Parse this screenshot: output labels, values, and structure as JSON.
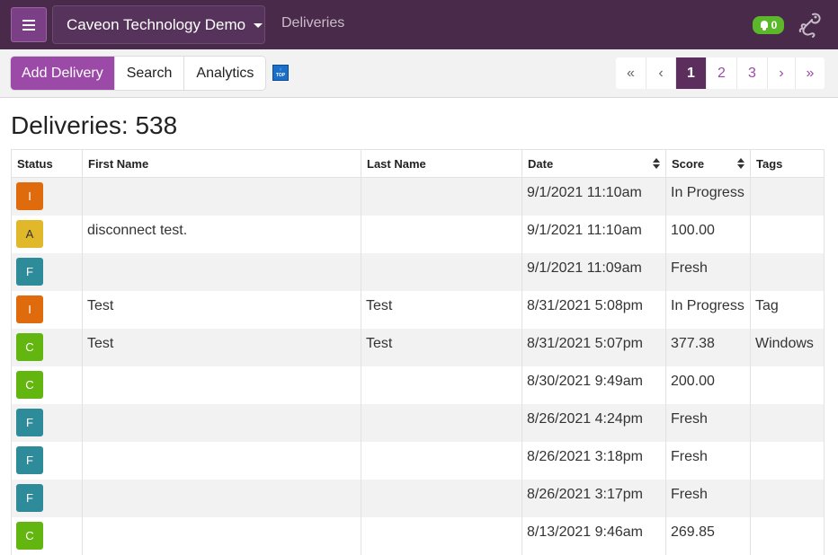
{
  "header": {
    "org_name": "Caveon Technology Demo",
    "breadcrumb": "Deliveries",
    "notification_count": "0"
  },
  "toolbar": {
    "add_label": "Add Delivery",
    "search_label": "Search",
    "analytics_label": "Analytics",
    "top_icon_text": "TOP",
    "pager": [
      "«",
      "‹",
      "1",
      "2",
      "3",
      "›",
      "»"
    ],
    "current_page": "1"
  },
  "page": {
    "title": "Deliveries: 538"
  },
  "table": {
    "columns": [
      "Status",
      "First Name",
      "Last Name",
      "Date",
      "Score",
      "Tags"
    ],
    "status_colors": {
      "I": "#e06b0c",
      "A": "#e0b82a",
      "F": "#2e8b99",
      "C": "#62b60f"
    },
    "rows": [
      {
        "status": "I",
        "first": "",
        "last": "",
        "date": "9/1/2021 11:10am",
        "score": "In Progress",
        "tags": ""
      },
      {
        "status": "A",
        "first": "disconnect test.",
        "last": "",
        "date": "9/1/2021 11:10am",
        "score": "100.00",
        "tags": ""
      },
      {
        "status": "F",
        "first": "",
        "last": "",
        "date": "9/1/2021 11:09am",
        "score": "Fresh",
        "tags": ""
      },
      {
        "status": "I",
        "first": "Test",
        "last": "Test",
        "date": "8/31/2021 5:08pm",
        "score": "In Progress",
        "tags": "Tag"
      },
      {
        "status": "C",
        "first": "Test",
        "last": "Test",
        "date": "8/31/2021 5:07pm",
        "score": "377.38",
        "tags": "Windows"
      },
      {
        "status": "C",
        "first": "",
        "last": "",
        "date": "8/30/2021 9:49am",
        "score": "200.00",
        "tags": ""
      },
      {
        "status": "F",
        "first": "",
        "last": "",
        "date": "8/26/2021 4:24pm",
        "score": "Fresh",
        "tags": ""
      },
      {
        "status": "F",
        "first": "",
        "last": "",
        "date": "8/26/2021 3:18pm",
        "score": "Fresh",
        "tags": ""
      },
      {
        "status": "F",
        "first": "",
        "last": "",
        "date": "8/26/2021 3:17pm",
        "score": "Fresh",
        "tags": ""
      },
      {
        "status": "C",
        "first": "",
        "last": "",
        "date": "8/13/2021 9:46am",
        "score": "269.85",
        "tags": ""
      }
    ]
  }
}
